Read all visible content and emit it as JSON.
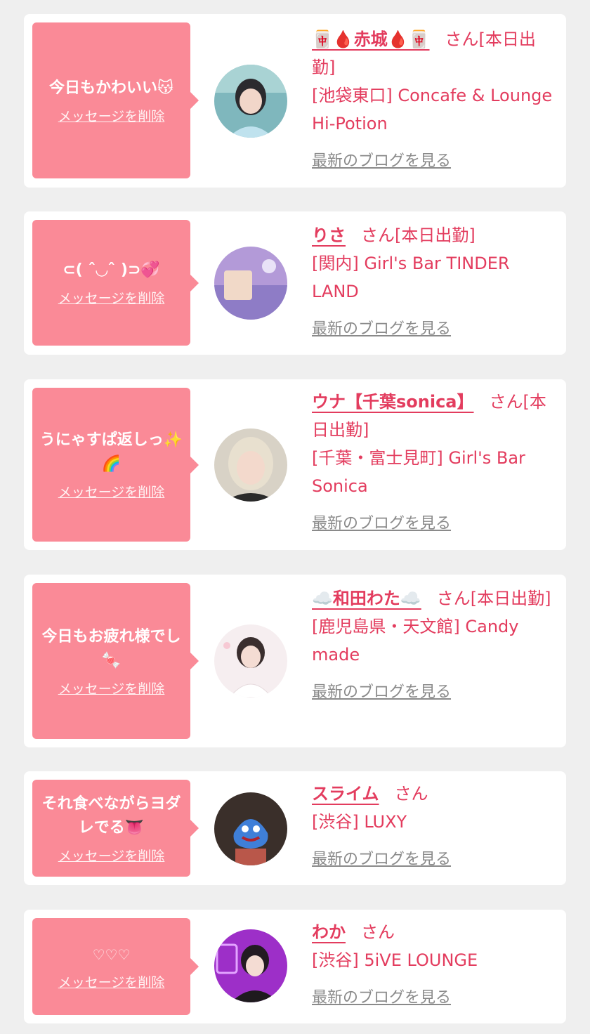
{
  "cards": [
    {
      "message": "今日もかわいい😽",
      "delete_label": "メッセージを削除",
      "name": "🀄🩸赤城🩸🀄",
      "status": "さん[本日出勤]",
      "shop": "[池袋東口] Concafe & Lounge Hi-Potion",
      "blog_label": "最新のブログを見る",
      "avatar_icon": "profile-photo"
    },
    {
      "message": "⊂( ˆ◡ˆ )⊃💞",
      "delete_label": "メッセージを削除",
      "name": "りさ",
      "status": "さん[本日出勤]",
      "shop": "[関内] Girl's Bar TINDER LAND",
      "blog_label": "最新のブログを見る",
      "avatar_icon": "profile-photo"
    },
    {
      "message": "うにゃすぱ返しっ✨🌈",
      "delete_label": "メッセージを削除",
      "name": "ウナ【千葉sonica】",
      "status": "さん[本日出勤]",
      "shop": "[千葉・富士見町] Girl's Bar Sonica",
      "blog_label": "最新のブログを見る",
      "avatar_icon": "profile-photo"
    },
    {
      "message": "今日もお疲れ様でし🍬",
      "delete_label": "メッセージを削除",
      "name": "☁️和田わた☁️",
      "status": "さん[本日出勤]",
      "shop": "[鹿児島県・天文館] Candy made",
      "blog_label": "最新のブログを見る",
      "avatar_icon": "profile-photo"
    },
    {
      "message": "それ食べながらヨダレでる👅",
      "delete_label": "メッセージを削除",
      "name": "スライム",
      "status": "さん",
      "shop": "[渋谷] LUXY",
      "blog_label": "最新のブログを見る",
      "avatar_icon": "profile-photo"
    },
    {
      "message": "♡♡♡",
      "delete_label": "メッセージを削除",
      "name": "わか",
      "status": "さん",
      "shop": "[渋谷] 5iVE LOUNGE",
      "blog_label": "最新のブログを見る",
      "avatar_icon": "profile-photo"
    }
  ],
  "colors": {
    "accent": "#e33c5e",
    "bubble": "#fa8a97",
    "card": "#ffffff",
    "page": "#efefef",
    "link_gray": "#8a8a8a"
  }
}
